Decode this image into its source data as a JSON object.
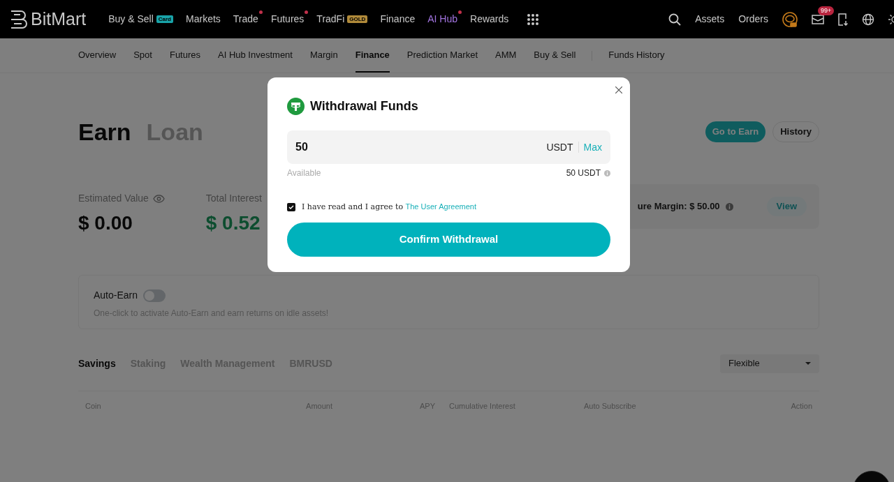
{
  "header": {
    "logo": "BitMart",
    "nav": [
      {
        "label": "Buy & Sell",
        "badge": {
          "text": "Card",
          "color": "#19a3a8"
        },
        "dot": false,
        "highlighted": false
      },
      {
        "label": "Markets",
        "dot": false,
        "highlighted": false
      },
      {
        "label": "Trade",
        "dot": true,
        "highlighted": false
      },
      {
        "label": "Futures",
        "dot": true,
        "highlighted": false
      },
      {
        "label": "TradFi",
        "badge": {
          "text": "GOLD",
          "color": "#b08a3a"
        },
        "dot": false,
        "highlighted": false
      },
      {
        "label": "Finance",
        "dot": false,
        "highlighted": false
      },
      {
        "label": "AI Hub",
        "dot": true,
        "highlighted": true
      },
      {
        "label": "Rewards",
        "dot": false,
        "highlighted": false
      }
    ],
    "links": [
      "Assets",
      "Orders"
    ],
    "notification_count": "99+"
  },
  "subnav": [
    {
      "label": "Overview",
      "selected": false,
      "divider_before": false
    },
    {
      "label": "Spot",
      "selected": false,
      "divider_before": false
    },
    {
      "label": "Futures",
      "selected": false,
      "divider_before": false
    },
    {
      "label": "AI Hub Investment",
      "selected": false,
      "divider_before": false
    },
    {
      "label": "Margin",
      "selected": false,
      "divider_before": false
    },
    {
      "label": "Finance",
      "selected": true,
      "divider_before": false
    },
    {
      "label": "Prediction Market",
      "selected": false,
      "divider_before": false
    },
    {
      "label": "AMM",
      "selected": false,
      "divider_before": false
    },
    {
      "label": "Buy & Sell",
      "selected": false,
      "divider_before": false
    },
    {
      "label": "Funds History",
      "selected": false,
      "divider_before": true
    }
  ],
  "page_tabs": [
    {
      "label": "Earn",
      "selected": true
    },
    {
      "label": "Loan",
      "selected": false
    }
  ],
  "actions": [
    "Go to Earn",
    "History"
  ],
  "stats": [
    {
      "label": "Estimated Value",
      "value": "$ 0.00",
      "positive": false
    },
    {
      "label": "Total Interest",
      "value": "$ 0.52",
      "positive": true
    }
  ],
  "margin_card": {
    "text": "ure Margin: $ 50.00",
    "button": "View"
  },
  "auto_earn": {
    "title": "Auto-Earn",
    "on": false,
    "description": "One-click to activate Auto-Earn and earn returns on idle assets!"
  },
  "product_tabs": [
    {
      "label": "Savings",
      "selected": true
    },
    {
      "label": "Staking",
      "selected": false
    },
    {
      "label": "Wealth Management",
      "selected": false
    },
    {
      "label": "BMRUSD",
      "selected": false
    }
  ],
  "filter": {
    "value": "Flexible"
  },
  "table": {
    "columns": [
      "Coin",
      "Amount",
      "APY",
      "Cumulative Interest",
      "Auto Subscribe",
      "Action"
    ]
  },
  "dialog": {
    "title": "Withdrawal Funds",
    "amount": "50",
    "currency": "USDT",
    "max": "Max",
    "available_label": "Available",
    "available_value": "50 USDT",
    "agree_checked": true,
    "agree_text": "I have read and I agree to",
    "agree_link": "The User Agreement",
    "confirm": "Confirm Withdrawal"
  }
}
